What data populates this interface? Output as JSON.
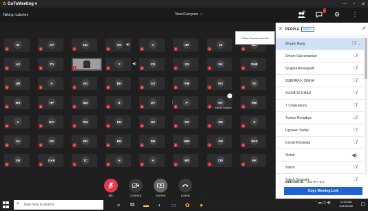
{
  "app": {
    "title": "GoToMeeting ▾",
    "logo": "✿"
  },
  "window_controls": [
    "—",
    "▫",
    "✕"
  ],
  "topbar": {
    "talking": "Talking: Lakshmi",
    "view": "View Everyone",
    "view_chevron": "◇",
    "participant_count": "56"
  },
  "toast": {
    "text": "Yutika Khanna has left."
  },
  "grid": {
    "tiles": [
      [
        "IN",
        "AP",
        "NG",
        "SS",
        "V",
        "HP",
        "AI",
        "MD"
      ],
      [
        "AS",
        "TD",
        "",
        "Y",
        "CD",
        "SD",
        "SK",
        "PHB"
      ],
      [
        "UR",
        "A",
        "AD",
        "BK",
        "AS",
        "PM",
        "RD",
        "YG"
      ],
      [
        "MS",
        "HP",
        "MD",
        "B",
        "UV",
        "P",
        "MT",
        "RM"
      ],
      [
        "A",
        "N/A",
        "RM",
        "KD",
        "HS",
        "RK",
        "SB",
        "S"
      ],
      [
        "SA",
        "DP",
        "RD",
        "RN",
        "DR",
        "MM",
        "AB",
        "SKS"
      ],
      [
        "SN",
        "DAK",
        "TC",
        "H",
        "A",
        "MS",
        "DB",
        "AK"
      ]
    ],
    "hover_label": "Mobile Thakkar"
  },
  "controls": [
    {
      "label": "Mic",
      "icon": "mic-off-icon"
    },
    {
      "label": "Camera",
      "icon": "camera-off-icon"
    },
    {
      "label": "Screen",
      "icon": "screen-share-icon"
    },
    {
      "label": "Leave",
      "icon": "phone-hangup-icon"
    }
  ],
  "panel": {
    "title": "PEOPLE",
    "count": "56/251",
    "participants": [
      "Shyam Bang",
      "Sriram Subramanian",
      "Srujana Amarapalli",
      "SUBHRA K SINHA",
      "SUSMITA DHAR",
      "T Chakraborty",
      "Tushar Devadiga",
      "Ugrasen Yadav",
      "Unnati Rotliwala",
      "Vishal",
      "Yatish",
      "Yatish Gujarathi"
    ],
    "meeting_id_label": "MEETING ID:",
    "meeting_id": "301-977-317",
    "copy_label": "Copy Meeting Link"
  },
  "taskbar": {
    "search_placeholder": "Type here to search",
    "time": "11:25 AM",
    "date": "10/10/2020"
  },
  "colors": {
    "accent": "#1e63d6",
    "mic_off": "#c62828",
    "panel_bg": "#ffffff",
    "stage_bg": "#1f1f1f"
  }
}
